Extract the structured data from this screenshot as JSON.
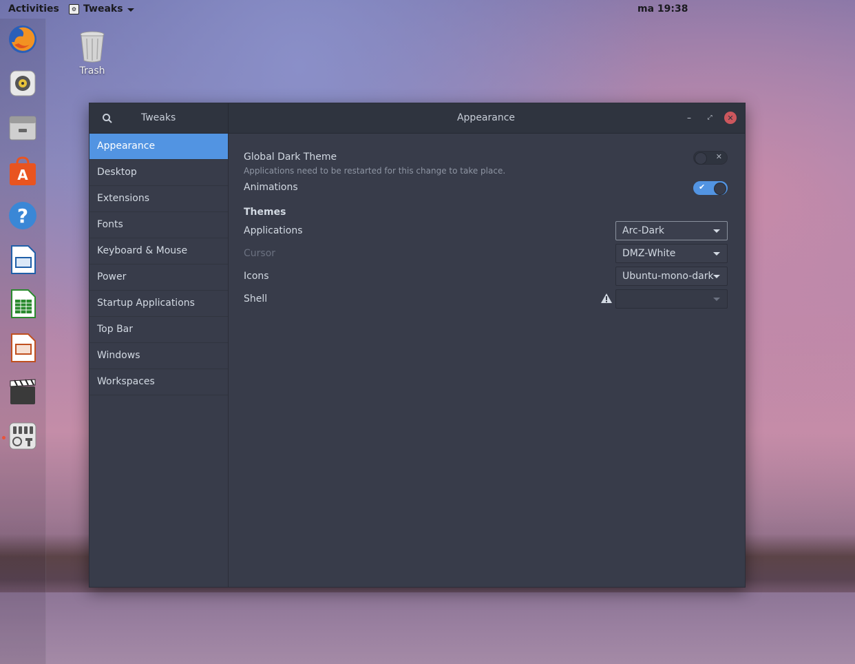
{
  "topbar": {
    "activities": "Activities",
    "app_name": "Tweaks",
    "clock": "ma 19:38"
  },
  "desktop": {
    "trash_label": "Trash"
  },
  "dock": {
    "items": [
      {
        "name": "Firefox"
      },
      {
        "name": "Rhythmbox"
      },
      {
        "name": "Files"
      },
      {
        "name": "Ubuntu Software"
      },
      {
        "name": "Help"
      },
      {
        "name": "LibreOffice Writer"
      },
      {
        "name": "LibreOffice Calc"
      },
      {
        "name": "LibreOffice Impress"
      },
      {
        "name": "Videos"
      },
      {
        "name": "Tweaks",
        "running": true
      }
    ]
  },
  "window": {
    "left_title": "Tweaks",
    "title": "Appearance",
    "sidebar": [
      {
        "label": "Appearance",
        "active": true
      },
      {
        "label": "Desktop"
      },
      {
        "label": "Extensions"
      },
      {
        "label": "Fonts"
      },
      {
        "label": "Keyboard & Mouse"
      },
      {
        "label": "Power"
      },
      {
        "label": "Startup Applications"
      },
      {
        "label": "Top Bar"
      },
      {
        "label": "Windows"
      },
      {
        "label": "Workspaces"
      }
    ],
    "content": {
      "global_dark_label": "Global Dark Theme",
      "global_dark_sub": "Applications need to be restarted for this change to take place.",
      "global_dark_on": false,
      "animations_label": "Animations",
      "animations_on": true,
      "themes_title": "Themes",
      "applications_label": "Applications",
      "applications_value": "Arc-Dark",
      "cursor_label": "Cursor",
      "cursor_value": "DMZ-White",
      "icons_label": "Icons",
      "icons_value": "Ubuntu-mono-dark",
      "shell_label": "Shell",
      "shell_value": ""
    }
  },
  "colors": {
    "accent": "#5294e2",
    "window_bg": "#383c4a",
    "headerbar_bg": "#2f343f",
    "close_button": "#cc575d"
  }
}
